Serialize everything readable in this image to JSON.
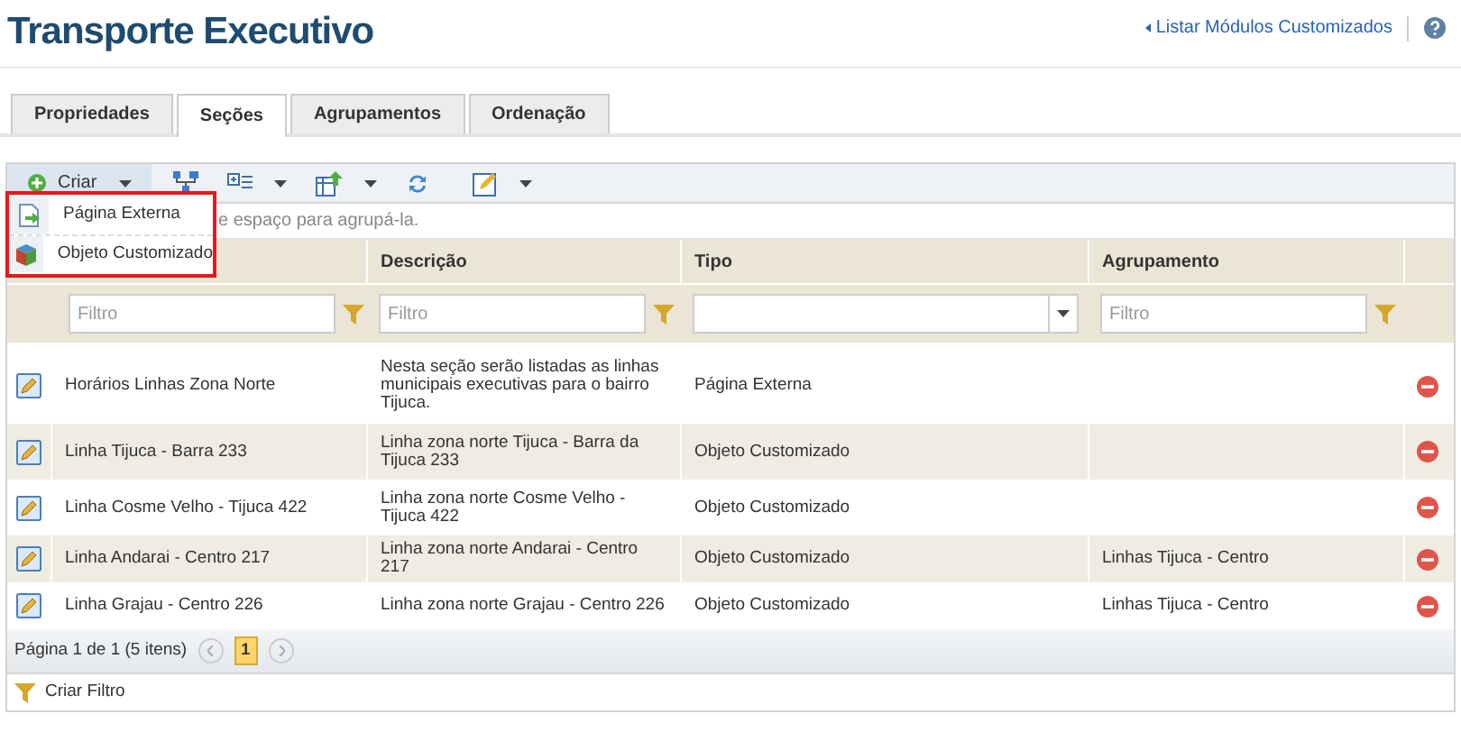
{
  "page": {
    "title": "Transporte Executivo",
    "back_link": "Listar Módulos Customizados"
  },
  "tabs": [
    {
      "label": "Propriedades",
      "selected": false
    },
    {
      "label": "Seções",
      "selected": true
    },
    {
      "label": "Agrupamentos",
      "selected": false
    },
    {
      "label": "Ordenação",
      "selected": false
    }
  ],
  "toolbar": {
    "create_button": "Criar"
  },
  "create_menu": [
    {
      "label": "Página Externa",
      "kind": "page"
    },
    {
      "label": "Objeto Customizado",
      "kind": "object"
    }
  ],
  "group_hint": "e espaço para agrupá-la.",
  "table": {
    "columns": [
      {
        "label": "Descrição",
        "kind": "text",
        "placeholder": "Filtro"
      },
      {
        "label": "Tipo",
        "kind": "select"
      },
      {
        "label": "Agrupamento",
        "kind": "text",
        "placeholder": "Filtro"
      }
    ],
    "name_filter_placeholder": "Filtro",
    "rows": [
      {
        "name": "Horários Linhas Zona Norte",
        "description": "Nesta seção serão listadas as linhas municipais executivas para o bairro Tijuca.",
        "type": "Página Externa",
        "group": ""
      },
      {
        "name": "Linha Tijuca - Barra 233",
        "description": "Linha zona norte Tijuca - Barra da Tijuca 233",
        "type": "Objeto Customizado",
        "group": ""
      },
      {
        "name": "Linha Cosme Velho - Tijuca 422",
        "description": "Linha zona norte Cosme Velho - Tijuca 422",
        "type": "Objeto Customizado",
        "group": ""
      },
      {
        "name": "Linha Andarai - Centro 217",
        "description": "Linha zona norte Andarai - Centro 217",
        "type": "Objeto Customizado",
        "group": "Linhas Tijuca - Centro"
      },
      {
        "name": "Linha Grajau - Centro 226",
        "description": "Linha zona norte Grajau - Centro 226",
        "type": "Objeto Customizado",
        "group": "Linhas Tijuca - Centro"
      }
    ]
  },
  "pager": {
    "summary": "Página 1 de 1 (5 itens)",
    "pages": [
      {
        "label": "1",
        "selected": true
      }
    ]
  },
  "footer": {
    "create_filter": "Criar Filtro"
  }
}
